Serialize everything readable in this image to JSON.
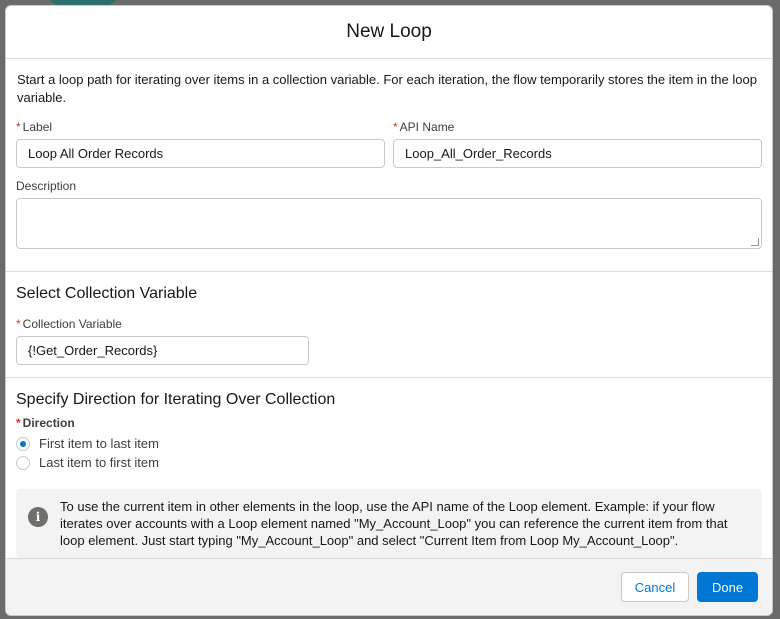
{
  "dialog": {
    "title": "New Loop",
    "description": "Start a loop path for iterating over items in a collection variable. For each iteration, the flow temporarily stores the item in the loop variable."
  },
  "required_mark": "*",
  "fields": {
    "label": {
      "label": "Label",
      "value": "Loop All Order Records"
    },
    "api_name": {
      "label": "API Name",
      "value": "Loop_All_Order_Records"
    },
    "description": {
      "label": "Description",
      "value": ""
    }
  },
  "collection_section": {
    "title": "Select Collection Variable",
    "field_label": "Collection Variable",
    "value": "{!Get_Order_Records}"
  },
  "direction_section": {
    "title": "Specify Direction for Iterating Over Collection",
    "field_label": "Direction",
    "options": [
      {
        "label": "First item to last item",
        "selected": true
      },
      {
        "label": "Last item to first item",
        "selected": false
      }
    ]
  },
  "info": {
    "icon": "info-icon",
    "text": "To use the current item in other elements in the loop, use the API name of the Loop element. Example: if your flow iterates over accounts with a Loop element named \"My_Account_Loop\" you can reference the current item from that loop element. Just start typing \"My_Account_Loop\" and select \"Current Item from Loop My_Account_Loop\"."
  },
  "footer": {
    "cancel_label": "Cancel",
    "done_label": "Done"
  },
  "colors": {
    "brand": "#0176d3",
    "required": "#c23934",
    "footer_bg": "#f3f3f3"
  }
}
